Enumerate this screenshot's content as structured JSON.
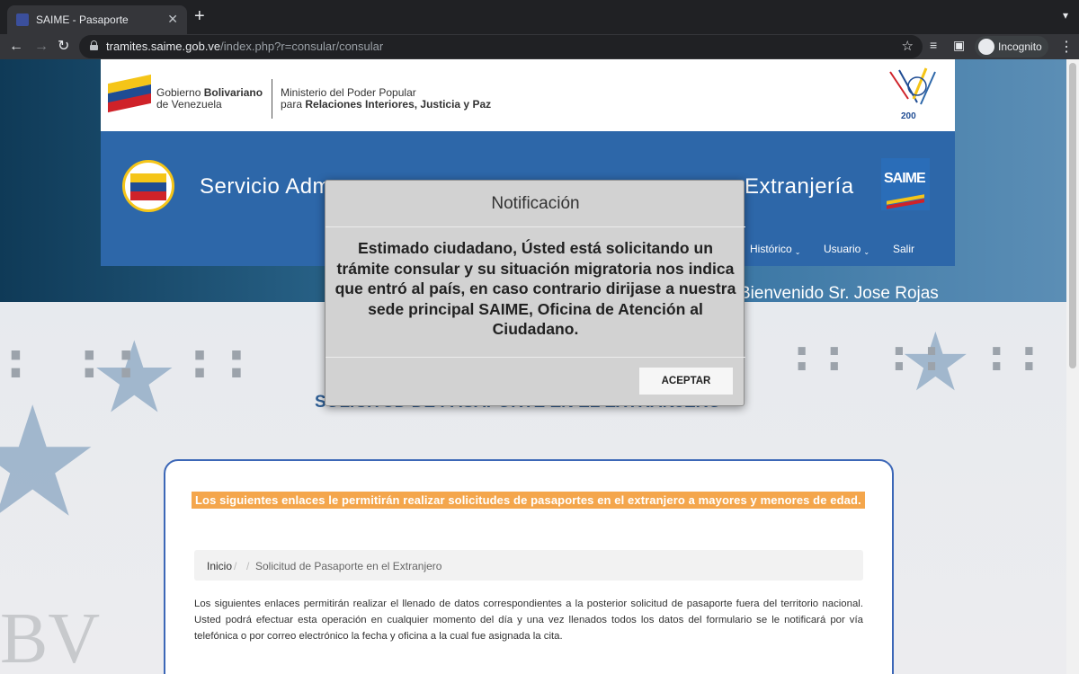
{
  "browser": {
    "tab_title": "SAIME - Pasaporte",
    "url_host": "tramites.saime.gob.ve",
    "url_path": "/index.php?r=consular/consular",
    "incognito_label": "Incognito"
  },
  "header": {
    "gob_line1_prefix": "Gobierno ",
    "gob_line1_bold": "Bolivariano",
    "gob_line2": "de Venezuela",
    "ministry_line1": "Ministerio del Poder Popular",
    "ministry_line2_prefix": "para ",
    "ministry_line2_bold": "Relaciones Interiores, Justicia y Paz",
    "bicentenario_years": "200",
    "service_title_start": "Servicio Adm",
    "service_title_end": "Extranjería",
    "saime_logo_text": "SAIME",
    "menu": [
      {
        "label": "Histórico"
      },
      {
        "label": "Usuario"
      },
      {
        "label": "Salir"
      }
    ],
    "welcome": "Bienvenido Sr. Jose Rojas"
  },
  "main": {
    "title": "SOLICITUD DE PASAPORTE EN EL EXTRANJERO",
    "notice": "Los siguientes enlaces le permitirán realizar solicitudes de pasaportes en el extranjero a mayores y menores de edad.",
    "breadcrumb": {
      "home": "Inicio",
      "sep1": "/",
      "sep2": "/",
      "current": "Solicitud de Pasaporte en el Extranjero"
    },
    "body_text": "Los siguientes enlaces permitirán realizar el llenado de datos correspondientes a la posterior solicitud de pasaporte fuera del territorio nacional. Usted podrá efectuar esta operación en cualquier momento del día y una vez llenados todos los datos del formulario se le notificará por vía telefónica o por correo electrónico la fecha y oficina a la cual fue asignada la cita."
  },
  "modal": {
    "title": "Notificación",
    "body": "Estimado ciudadano, Ústed está solicitando un trámite consular y su situación migratoria nos indica que entró al país, en caso contrario dirijase a nuestra sede principal SAIME, Oficina de Atención al Ciudadano.",
    "button": "ACEPTAR"
  },
  "colors": {
    "header_blue": "#2d67a9",
    "notice_orange": "#f4a64c",
    "title_blue": "#2f5f95",
    "card_border": "#3c67b7"
  }
}
